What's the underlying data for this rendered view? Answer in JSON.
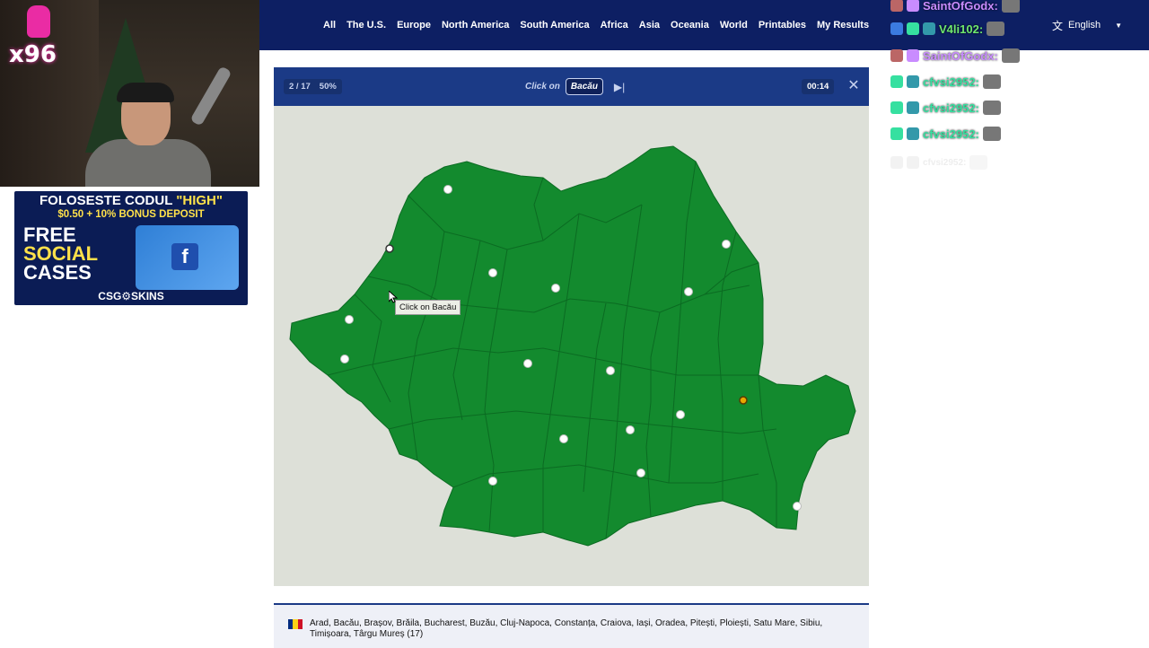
{
  "nav": {
    "links": [
      "All",
      "The U.S.",
      "Europe",
      "North America",
      "South America",
      "Africa",
      "Asia",
      "Oceania",
      "World",
      "Printables",
      "My Results"
    ],
    "language": "English",
    "language_icon": "translate-icon"
  },
  "webcam": {
    "badge": "x96"
  },
  "ad": {
    "line1_prefix": "FOLOSESTE CODUL ",
    "line1_highlight": "\"HIGH\"",
    "line2": "$0.50 + 10% BONUS DEPOSIT",
    "line3a": "FREE",
    "line3b": "SOCIAL",
    "line3c": "CASES",
    "line4": "CSG⚙SKINS",
    "case_icon": "f"
  },
  "chat": {
    "rows": [
      {
        "name": "SaintOfGodx:",
        "color": "#c98cff"
      },
      {
        "name": "V4li102:",
        "color": "#6fe86f"
      },
      {
        "name": "SaintOfGodx:",
        "color": "#c98cff"
      },
      {
        "name": "cfvsi2952:",
        "color": "#36e0a0"
      },
      {
        "name": "cfvsi2952:",
        "color": "#36e0a0"
      },
      {
        "name": "cfvsi2952:",
        "color": "#36e0a0"
      },
      {
        "name": "cfvsi2952:",
        "color": "#e8e8e8"
      }
    ]
  },
  "quiz": {
    "progress": "2 / 17",
    "percent": "50%",
    "click_on_label": "Click on",
    "target": "Bacău",
    "timer": "00:14",
    "tooltip": "Click on Bacău",
    "colors": {
      "land": "#138a2e",
      "borders": "#0b6b22",
      "background": "#dde0d8",
      "header": "#1b3a86"
    }
  },
  "answers": {
    "text": "Arad, Bacău, Brașov, Brăila, Bucharest, Buzău, Cluj-Napoca, Constanța, Craiova, Iași, Oradea, Pitești, Ploiești, Satu Mare, Sibiu, Timișoara, Târgu Mureș (17)",
    "flag_colors": [
      "#002b7f",
      "#fcd116",
      "#ce1126"
    ]
  }
}
